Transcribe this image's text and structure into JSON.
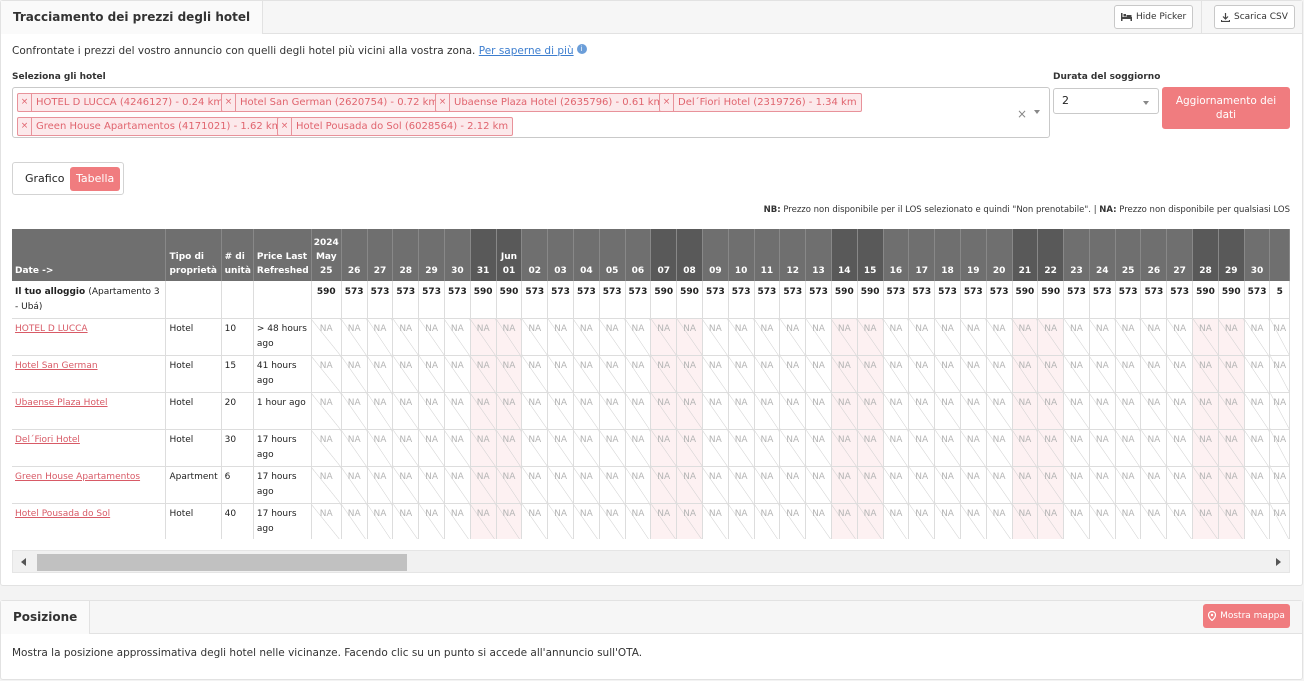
{
  "tracking": {
    "title": "Tracciamento dei prezzi degli hotel",
    "hide_picker": "Hide Picker",
    "export_csv": "Scarica CSV",
    "intro_text": "Confrontate i prezzi del vostro annuncio con quelli degli hotel più vicini alla vostra zona.",
    "intro_link": "Per saperne di più",
    "hotels_label": "Seleziona gli hotel",
    "selected_hotels": [
      "HOTEL D LUCCA (4246127) - 0.24 km",
      "Hotel San German (2620754) - 0.72 km",
      "Ubaense Plaza Hotel (2635796) - 0.61 km",
      "Del´Fiori Hotel (2319726) - 1.34 km",
      "Green House Apartamentos (4171021) - 1.62 km",
      "Hotel Pousada do Sol (6028564) - 2.12 km"
    ],
    "duration_label": "Durata del soggiorno",
    "duration_value": "2",
    "update_button": "Aggiornamento dei dati",
    "view_toggle": {
      "chart": "Grafico",
      "table": "Tabella",
      "active": "Tabella"
    },
    "note_nb_label": "NB:",
    "note_nb_text": "Prezzo non disponibile per il LOS selezionato e quindi \"Non prenotabile\". |",
    "note_na_label": "NA:",
    "note_na_text": "Prezzo non disponibile per qualsiasi LOS"
  },
  "table": {
    "headers": {
      "date": "Date ->",
      "type": "Tipo di proprietà",
      "units": "# di unità",
      "refreshed": "Price Last Refreshed"
    },
    "dates": [
      {
        "top": "2024",
        "mid": "May",
        "day": "25",
        "weekend": false
      },
      {
        "day": "26",
        "weekend": false
      },
      {
        "day": "27",
        "weekend": false
      },
      {
        "day": "28",
        "weekend": false
      },
      {
        "day": "29",
        "weekend": false
      },
      {
        "day": "30",
        "weekend": false
      },
      {
        "day": "31",
        "weekend": true
      },
      {
        "mid": "Jun",
        "day": "01",
        "weekend": true
      },
      {
        "day": "02",
        "weekend": false
      },
      {
        "day": "03",
        "weekend": false
      },
      {
        "day": "04",
        "weekend": false
      },
      {
        "day": "05",
        "weekend": false
      },
      {
        "day": "06",
        "weekend": false
      },
      {
        "day": "07",
        "weekend": true
      },
      {
        "day": "08",
        "weekend": true
      },
      {
        "day": "09",
        "weekend": false
      },
      {
        "day": "10",
        "weekend": false
      },
      {
        "day": "11",
        "weekend": false
      },
      {
        "day": "12",
        "weekend": false
      },
      {
        "day": "13",
        "weekend": false
      },
      {
        "day": "14",
        "weekend": true
      },
      {
        "day": "15",
        "weekend": true
      },
      {
        "day": "16",
        "weekend": false
      },
      {
        "day": "17",
        "weekend": false
      },
      {
        "day": "18",
        "weekend": false
      },
      {
        "day": "19",
        "weekend": false
      },
      {
        "day": "20",
        "weekend": false
      },
      {
        "day": "21",
        "weekend": true
      },
      {
        "day": "22",
        "weekend": true
      },
      {
        "day": "23",
        "weekend": false
      },
      {
        "day": "24",
        "weekend": false
      },
      {
        "day": "25",
        "weekend": false
      },
      {
        "day": "26",
        "weekend": false
      },
      {
        "day": "27",
        "weekend": false
      },
      {
        "day": "28",
        "weekend": true
      },
      {
        "day": "29",
        "weekend": true
      },
      {
        "day": "30",
        "weekend": false
      },
      {
        "day": "",
        "weekend": false
      }
    ],
    "your_listing": {
      "label": "Il tuo alloggio",
      "sub": "(Apartamento 3 - Ubá)",
      "prices": [
        "590",
        "573",
        "573",
        "573",
        "573",
        "573",
        "590",
        "590",
        "573",
        "573",
        "573",
        "573",
        "573",
        "590",
        "590",
        "573",
        "573",
        "573",
        "573",
        "573",
        "590",
        "590",
        "573",
        "573",
        "573",
        "573",
        "573",
        "590",
        "590",
        "573",
        "573",
        "573",
        "573",
        "573",
        "590",
        "590",
        "573",
        "5"
      ]
    },
    "na_value": "NA",
    "hotels": [
      {
        "name": "HOTEL D LUCCA",
        "type": "Hotel",
        "units": "10",
        "refreshed": "> 48 hours ago"
      },
      {
        "name": "Hotel San German",
        "type": "Hotel",
        "units": "15",
        "refreshed": "41 hours ago"
      },
      {
        "name": "Ubaense Plaza Hotel",
        "type": "Hotel",
        "units": "20",
        "refreshed": "1 hour ago"
      },
      {
        "name": "Del´Fiori Hotel",
        "type": "Hotel",
        "units": "30",
        "refreshed": "17 hours ago"
      },
      {
        "name": "Green House Apartamentos",
        "type": "Apartment",
        "units": "6",
        "refreshed": "17 hours ago"
      },
      {
        "name": "Hotel Pousada do Sol",
        "type": "Hotel",
        "units": "40",
        "refreshed": "17 hours ago"
      }
    ]
  },
  "position": {
    "title": "Posizione",
    "map_button": "Mostra mappa",
    "description": "Mostra la posizione approssimativa degli hotel nelle vicinanze. Facendo clic su un punto si accede all'annuncio sull'OTA."
  },
  "colors": {
    "accent": "#f07c7f",
    "chip_text": "#e0646e",
    "link": "#3d7ecf",
    "header_bg": "#6f6f6f"
  }
}
